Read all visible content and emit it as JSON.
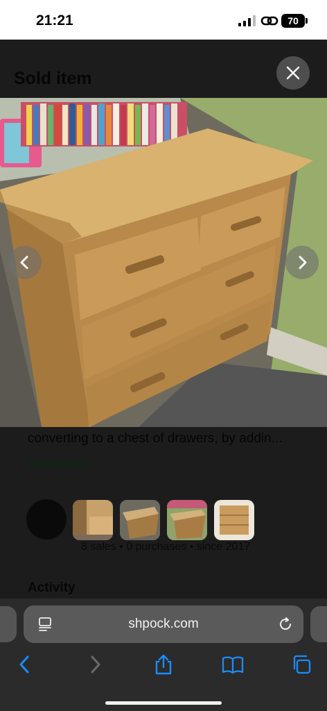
{
  "status_bar": {
    "time": "21:21",
    "battery": "70"
  },
  "page": {
    "title": "Sold item",
    "description": "converting to a chest of drawers, by addin...",
    "read_more": "Read more",
    "seller": {
      "stats": "8 sales • 0 purchases • since 2017"
    },
    "activity_title": "Activity"
  },
  "browser": {
    "url": "shpock.com"
  },
  "icons": {
    "close": "close-icon",
    "prev": "chevron-left-icon",
    "next": "chevron-right-icon",
    "page_menu": "page-menu-icon",
    "reload": "reload-icon",
    "back": "back-icon",
    "forward": "forward-icon",
    "share": "share-icon",
    "bookmarks": "book-icon",
    "tabs": "tabs-icon"
  },
  "colors": {
    "accent": "#1a8cff",
    "dimmed_overlay": "#1c1c1c"
  }
}
